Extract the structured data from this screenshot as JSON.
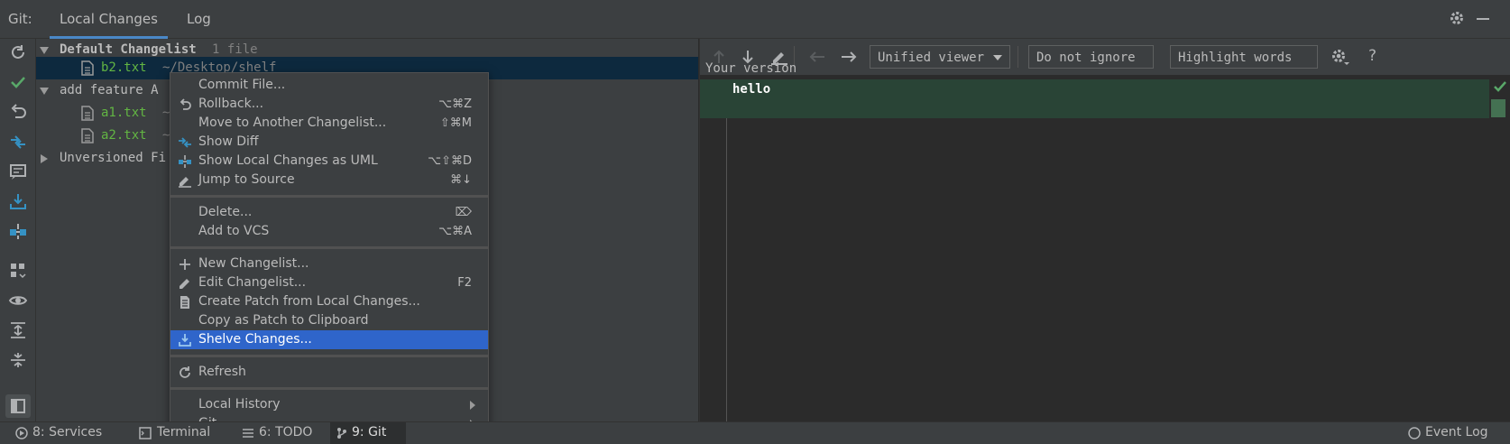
{
  "header": {
    "title": "Git:",
    "tabs": [
      {
        "label": "Local Changes"
      },
      {
        "label": "Log"
      }
    ]
  },
  "tree": {
    "default_changelist": {
      "name": "Default Changelist",
      "count": "1 file"
    },
    "b2_file": {
      "name": "b2.txt",
      "path": "~/Desktop/shelf"
    },
    "feature_changelist": {
      "name": "add feature A"
    },
    "a1_file": {
      "name": "a1.txt",
      "path": "~"
    },
    "a2_file": {
      "name": "a2.txt",
      "path": "~"
    },
    "unversioned": {
      "name": "Unversioned Fi"
    }
  },
  "diff": {
    "viewer_combo": "Unified viewer",
    "ignore_combo": "Do not ignore",
    "highlight_combo": "Highlight words",
    "help_label": "?",
    "your_version_label": "Your version",
    "line_text": "hello",
    "added_line_color": "#294436"
  },
  "context_menu": {
    "items": [
      {
        "label": "Commit File...",
        "shortcut": ""
      },
      {
        "label": "Rollback...",
        "shortcut": "⌥⌘Z"
      },
      {
        "label": "Move to Another Changelist...",
        "shortcut": "⇧⌘M"
      },
      {
        "label": "Show Diff",
        "shortcut": ""
      },
      {
        "label": "Show Local Changes as UML",
        "shortcut": "⌥⇧⌘D"
      },
      {
        "label": "Jump to Source",
        "shortcut": "⌘↓"
      },
      {
        "label": "Delete...",
        "shortcut": "⌦"
      },
      {
        "label": "Add to VCS",
        "shortcut": "⌥⌘A"
      },
      {
        "label": "New Changelist...",
        "shortcut": ""
      },
      {
        "label": "Edit Changelist...",
        "shortcut": "F2"
      },
      {
        "label": "Create Patch from Local Changes...",
        "shortcut": ""
      },
      {
        "label": "Copy as Patch to Clipboard",
        "shortcut": ""
      },
      {
        "label": "Shelve Changes...",
        "shortcut": ""
      },
      {
        "label": "Refresh",
        "shortcut": ""
      },
      {
        "label": "Local History",
        "shortcut": ""
      },
      {
        "label": "Git",
        "shortcut": ""
      }
    ],
    "selected_color": "#2f65ca"
  },
  "statusbar": {
    "services": "8: Services",
    "terminal": "Terminal",
    "todo": "6: TODO",
    "git": "9: Git",
    "event_log": "Event Log"
  }
}
